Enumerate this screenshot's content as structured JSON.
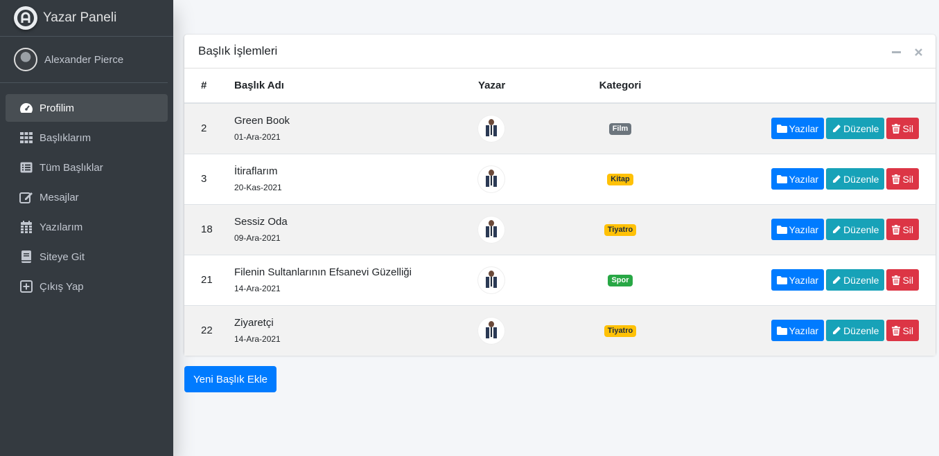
{
  "brand": {
    "title": "Yazar Paneli",
    "logo_icon": "a-logo-icon"
  },
  "user": {
    "name": "Alexander Pierce"
  },
  "nav": [
    {
      "label": "Profilim",
      "icon": "tachometer-icon",
      "active": true
    },
    {
      "label": "Başlıklarım",
      "icon": "grid-icon"
    },
    {
      "label": "Tüm Başlıklar",
      "icon": "list-icon"
    },
    {
      "label": "Mesajlar",
      "icon": "edit-icon"
    },
    {
      "label": "Yazılarım",
      "icon": "calendar-icon"
    },
    {
      "label": "Siteye Git",
      "icon": "book-icon"
    },
    {
      "label": "Çıkış Yap",
      "icon": "plus-square-icon"
    }
  ],
  "card": {
    "title": "Başlık İşlemleri"
  },
  "table": {
    "headers": {
      "num": "#",
      "title": "Başlık Adı",
      "author": "Yazar",
      "category": "Kategori"
    },
    "rows": [
      {
        "id": "2",
        "title": "Green Book",
        "date": "01-Ara-2021",
        "category": "Film",
        "category_style": "secondary"
      },
      {
        "id": "3",
        "title": "İtiraflarım",
        "date": "20-Kas-2021",
        "category": "Kitap",
        "category_style": "warning"
      },
      {
        "id": "18",
        "title": "Sessiz Oda",
        "date": "09-Ara-2021",
        "category": "Tiyatro",
        "category_style": "warning"
      },
      {
        "id": "21",
        "title": "Filenin Sultanlarının Efsanevi Güzelliği",
        "date": "14-Ara-2021",
        "category": "Spor",
        "category_style": "success"
      },
      {
        "id": "22",
        "title": "Ziyaretçi",
        "date": "14-Ara-2021",
        "category": "Tiyatro",
        "category_style": "warning"
      }
    ],
    "actions": {
      "posts": "Yazılar",
      "edit": "Düzenle",
      "delete": "Sil"
    }
  },
  "add_button": "Yeni Başlık Ekle",
  "colors": {
    "primary": "#007bff",
    "info": "#17a2b8",
    "danger": "#dc3545",
    "sidebar": "#343a40"
  }
}
